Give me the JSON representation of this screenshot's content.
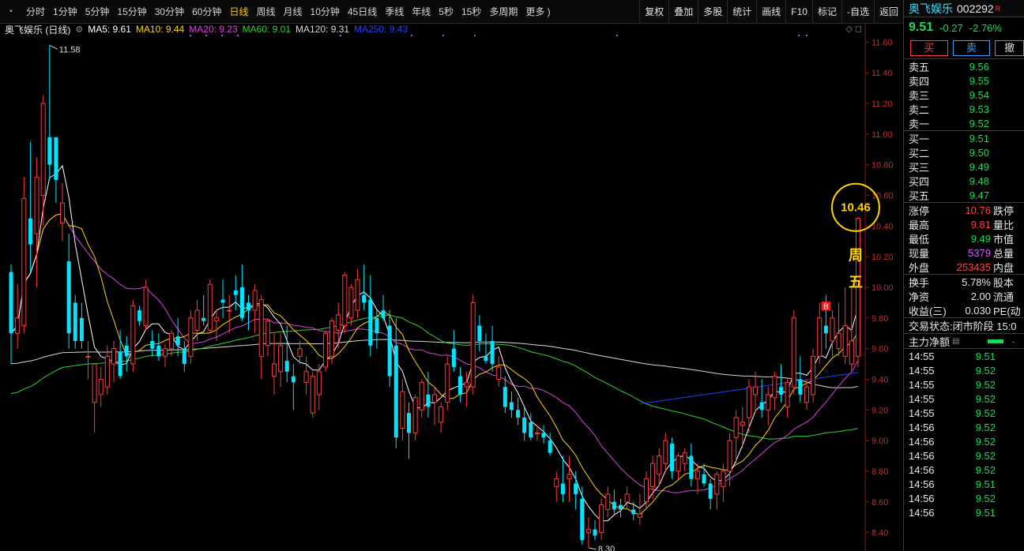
{
  "toolbar": {
    "periods": [
      "分时",
      "1分钟",
      "5分钟",
      "15分钟",
      "30分钟",
      "60分钟",
      "日线",
      "周线",
      "月线",
      "10分钟",
      "45日线",
      "季线",
      "年线",
      "5秒",
      "15秒",
      "多周期",
      "更多 )"
    ],
    "active_period": "日线",
    "actions": [
      "复权",
      "叠加",
      "多股",
      "统计",
      "画线",
      "F10",
      "标记",
      "-自选",
      "返回"
    ]
  },
  "legend": {
    "stock_label": "奥飞娱乐 (日线)",
    "ma": [
      {
        "text": "MA5: 9.61",
        "color": "#ffffff"
      },
      {
        "text": "MA10: 9.44",
        "color": "#ffd400"
      },
      {
        "text": "MA20: 9.23",
        "color": "#e040e0"
      },
      {
        "text": "MA60: 9.01",
        "color": "#30d030"
      },
      {
        "text": "MA120: 9.31",
        "color": "#d8d8d8"
      },
      {
        "text": "MA250: 9.43",
        "color": "#2040ff"
      }
    ]
  },
  "annotations": {
    "high_label": "11.58",
    "low_label": "8.30",
    "circle_value": "10.46",
    "weekday_text_1": "周",
    "weekday_text_2": "五",
    "b_marker": "B"
  },
  "chart_data": {
    "type": "candlestick",
    "ylim": [
      8.3,
      11.7
    ],
    "y_ticks": [
      8.4,
      8.6,
      8.8,
      9.0,
      9.2,
      9.4,
      9.6,
      9.8,
      10.0,
      10.2,
      10.4,
      10.6,
      10.8,
      11.0,
      11.2,
      11.4,
      11.6
    ],
    "up_color": "#ff3b3b",
    "down_color": "#00e5ff",
    "candles": [
      [
        10.1,
        10.15,
        9.5,
        9.7
      ],
      [
        9.7,
        10.02,
        9.6,
        9.8
      ],
      [
        9.75,
        10.72,
        9.7,
        10.58
      ],
      [
        10.45,
        10.95,
        10.1,
        10.28
      ],
      [
        10.35,
        10.85,
        10.0,
        10.72
      ],
      [
        10.6,
        11.25,
        10.4,
        11.2
      ],
      [
        10.98,
        11.58,
        10.7,
        10.8
      ],
      [
        10.98,
        10.98,
        10.55,
        10.7
      ],
      [
        10.42,
        10.68,
        10.3,
        10.55
      ],
      [
        10.17,
        10.35,
        9.6,
        9.7
      ],
      [
        9.9,
        9.95,
        9.6,
        9.65
      ],
      [
        9.8,
        9.9,
        9.6,
        9.65
      ],
      [
        9.55,
        9.65,
        9.4,
        9.55
      ],
      [
        9.25,
        9.48,
        9.05,
        9.5
      ],
      [
        9.3,
        9.48,
        9.22,
        9.4
      ],
      [
        9.35,
        9.62,
        9.3,
        9.55
      ],
      [
        9.5,
        9.65,
        9.38,
        9.6
      ],
      [
        9.58,
        9.72,
        9.4,
        9.42
      ],
      [
        9.62,
        9.68,
        9.45,
        9.55
      ],
      [
        9.5,
        9.92,
        9.45,
        9.88
      ],
      [
        9.85,
        9.88,
        9.75,
        9.78
      ],
      [
        9.75,
        10.05,
        9.72,
        10.0
      ],
      [
        9.65,
        9.72,
        9.55,
        9.6
      ],
      [
        9.62,
        9.7,
        9.52,
        9.55
      ],
      [
        9.55,
        9.63,
        9.48,
        9.6
      ],
      [
        9.6,
        9.72,
        9.55,
        9.7
      ],
      [
        9.68,
        9.8,
        9.55,
        9.62
      ],
      [
        9.6,
        9.65,
        9.45,
        9.5
      ],
      [
        9.55,
        9.85,
        9.5,
        9.8
      ],
      [
        9.72,
        9.92,
        9.65,
        9.85
      ],
      [
        9.8,
        9.95,
        9.75,
        9.78
      ],
      [
        9.72,
        10.05,
        9.7,
        10.02
      ],
      [
        9.78,
        9.85,
        9.65,
        9.8
      ],
      [
        9.92,
        10.05,
        9.8,
        9.9
      ],
      [
        9.85,
        9.95,
        9.7,
        9.85
      ],
      [
        9.98,
        10.08,
        9.85,
        9.95
      ],
      [
        10.0,
        10.15,
        9.78,
        9.8
      ],
      [
        9.9,
        9.95,
        9.72,
        9.85
      ],
      [
        9.85,
        10.02,
        9.7,
        9.98
      ],
      [
        9.55,
        9.95,
        9.4,
        9.92
      ],
      [
        9.62,
        9.8,
        9.55,
        9.78
      ],
      [
        9.42,
        9.7,
        9.3,
        9.5
      ],
      [
        9.45,
        9.7,
        9.35,
        9.62
      ],
      [
        9.52,
        9.75,
        9.38,
        9.45
      ],
      [
        9.42,
        9.5,
        9.2,
        9.38
      ],
      [
        9.55,
        9.65,
        9.5,
        9.6
      ],
      [
        9.38,
        9.55,
        9.3,
        9.45
      ],
      [
        9.18,
        9.45,
        9.15,
        9.42
      ],
      [
        9.3,
        9.5,
        9.2,
        9.45
      ],
      [
        9.48,
        9.72,
        9.45,
        9.7
      ],
      [
        9.55,
        9.8,
        9.5,
        9.78
      ],
      [
        9.72,
        9.9,
        9.6,
        9.82
      ],
      [
        9.75,
        10.1,
        9.7,
        10.08
      ],
      [
        9.8,
        10.02,
        9.75,
        10.0
      ],
      [
        9.85,
        10.12,
        9.8,
        10.05
      ],
      [
        9.95,
        10.15,
        9.85,
        9.9
      ],
      [
        9.92,
        10.08,
        9.55,
        9.62
      ],
      [
        9.8,
        9.85,
        9.6,
        9.7
      ],
      [
        9.85,
        9.95,
        9.78,
        9.8
      ],
      [
        9.75,
        9.85,
        9.35,
        9.42
      ],
      [
        9.62,
        9.8,
        8.95,
        9.02
      ],
      [
        9.08,
        9.4,
        9.0,
        9.32
      ],
      [
        9.18,
        9.25,
        8.88,
        9.05
      ],
      [
        9.05,
        9.3,
        9.0,
        9.28
      ],
      [
        9.2,
        9.4,
        9.15,
        9.38
      ],
      [
        9.3,
        9.45,
        9.15,
        9.22
      ],
      [
        9.25,
        9.35,
        9.1,
        9.3
      ],
      [
        9.12,
        9.25,
        9.05,
        9.22
      ],
      [
        9.25,
        9.55,
        9.2,
        9.5
      ],
      [
        9.6,
        9.72,
        9.45,
        9.48
      ],
      [
        9.42,
        9.48,
        9.25,
        9.3
      ],
      [
        9.35,
        9.45,
        9.22,
        9.38
      ],
      [
        9.35,
        9.95,
        9.3,
        9.9
      ],
      [
        9.75,
        9.82,
        9.58,
        9.65
      ],
      [
        9.55,
        9.7,
        9.5,
        9.52
      ],
      [
        9.65,
        9.75,
        9.45,
        9.5
      ],
      [
        9.4,
        9.55,
        9.35,
        9.48
      ],
      [
        9.35,
        9.42,
        9.18,
        9.22
      ],
      [
        9.25,
        9.32,
        9.15,
        9.2
      ],
      [
        9.2,
        9.28,
        9.1,
        9.15
      ],
      [
        9.15,
        9.22,
        9.0,
        9.05
      ],
      [
        9.12,
        9.18,
        9.0,
        9.02
      ],
      [
        9.05,
        9.1,
        9.0,
        9.05
      ],
      [
        9.05,
        9.1,
        8.98,
        9.02
      ],
      [
        9.0,
        9.05,
        8.9,
        8.92
      ],
      [
        8.7,
        8.8,
        8.6,
        8.75
      ],
      [
        8.72,
        8.9,
        8.6,
        8.65
      ],
      [
        8.75,
        8.9,
        8.6,
        8.78
      ],
      [
        8.72,
        8.8,
        8.55,
        8.65
      ],
      [
        8.62,
        8.7,
        8.32,
        8.35
      ],
      [
        8.4,
        8.5,
        8.3,
        8.42
      ],
      [
        8.42,
        8.48,
        8.35,
        8.38
      ],
      [
        8.4,
        8.62,
        8.35,
        8.58
      ],
      [
        8.55,
        8.7,
        8.5,
        8.65
      ],
      [
        8.6,
        8.68,
        8.52,
        8.55
      ],
      [
        8.58,
        8.62,
        8.5,
        8.55
      ],
      [
        8.6,
        8.7,
        8.55,
        8.65
      ],
      [
        8.55,
        8.6,
        8.48,
        8.52
      ],
      [
        8.5,
        8.65,
        8.45,
        8.52
      ],
      [
        8.6,
        8.8,
        8.55,
        8.75
      ],
      [
        8.7,
        8.9,
        8.62,
        8.85
      ],
      [
        8.78,
        8.95,
        8.7,
        8.9
      ],
      [
        8.85,
        9.05,
        8.8,
        9.0
      ],
      [
        8.98,
        9.02,
        8.75,
        8.8
      ],
      [
        8.8,
        8.92,
        8.75,
        8.9
      ],
      [
        8.85,
        8.95,
        8.8,
        8.92
      ],
      [
        8.9,
        8.98,
        8.7,
        8.75
      ],
      [
        8.75,
        8.85,
        8.65,
        8.8
      ],
      [
        8.78,
        8.85,
        8.7,
        8.72
      ],
      [
        8.72,
        8.75,
        8.55,
        8.62
      ],
      [
        8.65,
        8.8,
        8.55,
        8.78
      ],
      [
        8.7,
        8.85,
        8.6,
        8.8
      ],
      [
        8.8,
        9.05,
        8.7,
        9.0
      ],
      [
        9.02,
        9.2,
        8.85,
        9.15
      ],
      [
        9.1,
        9.22,
        8.95,
        9.12
      ],
      [
        9.15,
        9.4,
        9.05,
        9.35
      ],
      [
        9.3,
        9.45,
        9.18,
        9.35
      ],
      [
        9.25,
        9.4,
        9.15,
        9.2
      ],
      [
        9.2,
        9.35,
        9.1,
        9.3
      ],
      [
        9.28,
        9.45,
        9.2,
        9.42
      ],
      [
        9.35,
        9.5,
        9.25,
        9.3
      ],
      [
        9.22,
        9.4,
        9.15,
        9.38
      ],
      [
        9.35,
        9.85,
        9.3,
        9.8
      ],
      [
        9.4,
        9.55,
        9.25,
        9.3
      ],
      [
        9.25,
        9.4,
        9.2,
        9.35
      ],
      [
        9.3,
        9.6,
        9.25,
        9.55
      ],
      [
        9.55,
        9.9,
        9.5,
        9.8
      ],
      [
        9.75,
        9.95,
        9.6,
        9.7
      ],
      [
        9.65,
        9.85,
        9.55,
        9.8
      ],
      [
        9.6,
        9.9,
        9.55,
        9.7
      ],
      [
        9.55,
        10.0,
        9.5,
        9.75
      ],
      [
        9.5,
        10.0,
        9.45,
        9.65
      ],
      [
        9.55,
        10.46,
        9.48,
        10.45
      ]
    ]
  },
  "panel": {
    "stock_name": "奥飞娱乐",
    "stock_code": "002292",
    "code_badge": "R",
    "price": "9.51",
    "change": "-0.27",
    "change_pct": "-2.76%",
    "buy_button": "买",
    "sell_button": "卖",
    "cancel_button": "撤",
    "sell_levels": [
      {
        "label": "卖五",
        "price": "9.56"
      },
      {
        "label": "卖四",
        "price": "9.55"
      },
      {
        "label": "卖三",
        "price": "9.54"
      },
      {
        "label": "卖二",
        "price": "9.53"
      },
      {
        "label": "卖一",
        "price": "9.52"
      }
    ],
    "buy_levels": [
      {
        "label": "买一",
        "price": "9.51"
      },
      {
        "label": "买二",
        "price": "9.50"
      },
      {
        "label": "买三",
        "price": "9.49"
      },
      {
        "label": "买四",
        "price": "9.48"
      },
      {
        "label": "买五",
        "price": "9.47"
      }
    ],
    "stats": [
      {
        "label": "涨停",
        "value": "10.76",
        "value_color": "red",
        "extra": "跌停"
      },
      {
        "label": "最高",
        "value": "9.81",
        "value_color": "red",
        "extra": "量比"
      },
      {
        "label": "最低",
        "value": "9.49",
        "value_color": "green",
        "extra": "市值"
      },
      {
        "label": "现量",
        "value": "5379",
        "value_color": "purple",
        "extra": "总量"
      },
      {
        "label": "外盘",
        "value": "253435",
        "value_color": "red",
        "extra": "内盘"
      }
    ],
    "stats2": [
      {
        "label": "换手",
        "value": "5.78%",
        "extra": "股本"
      },
      {
        "label": "净资",
        "value": "2.00",
        "extra": "流通"
      },
      {
        "label": "收益(三)",
        "value": "0.030",
        "extra": "PE(动"
      }
    ],
    "trade_status_label": "交易状态:",
    "trade_status_value": "闭市阶段 15:0",
    "main_flow_label": "主力净额",
    "ticks": [
      {
        "time": "14:55",
        "price": "9.51"
      },
      {
        "time": "14:55",
        "price": "9.52"
      },
      {
        "time": "14:55",
        "price": "9.52"
      },
      {
        "time": "14:55",
        "price": "9.52"
      },
      {
        "time": "14:55",
        "price": "9.52"
      },
      {
        "time": "14:56",
        "price": "9.52"
      },
      {
        "time": "14:56",
        "price": "9.52"
      },
      {
        "time": "14:56",
        "price": "9.52"
      },
      {
        "time": "14:56",
        "price": "9.52"
      },
      {
        "time": "14:56",
        "price": "9.51"
      },
      {
        "time": "14:56",
        "price": "9.52"
      },
      {
        "time": "14:56",
        "price": "9.51"
      }
    ]
  }
}
